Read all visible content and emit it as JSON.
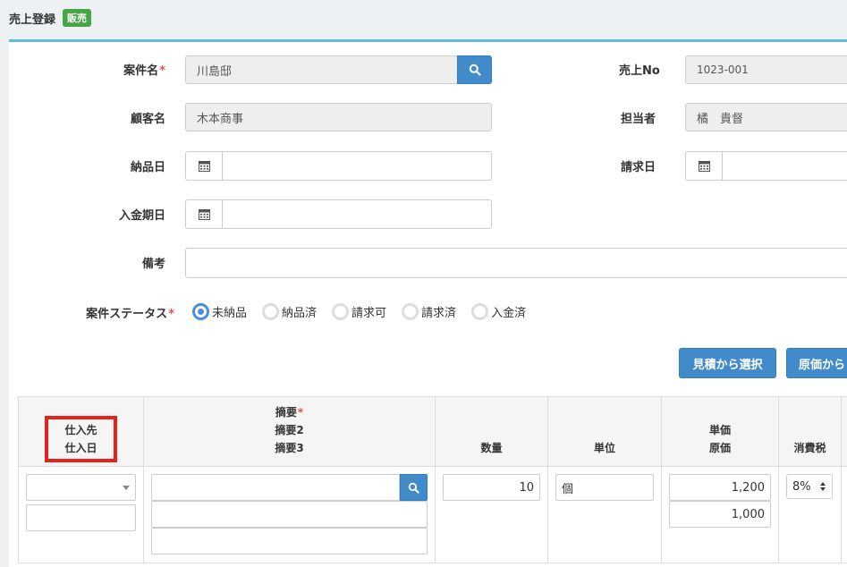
{
  "header": {
    "title": "売上登録",
    "badge": "販売"
  },
  "form": {
    "project_name": {
      "label": "案件名",
      "value": "川島邸"
    },
    "sales_no": {
      "label": "売上No",
      "value": "1023-001"
    },
    "customer": {
      "label": "顧客名",
      "value": "木本商事"
    },
    "staff": {
      "label": "担当者",
      "value": "橘　貴督"
    },
    "delivery_date": {
      "label": "納品日",
      "value": ""
    },
    "billing_date": {
      "label": "請求日",
      "value": ""
    },
    "payment_due": {
      "label": "入金期日",
      "value": ""
    },
    "memo": {
      "label": "備考",
      "value": ""
    },
    "status": {
      "label": "案件ステータス",
      "options": [
        "未納品",
        "納品済",
        "請求可",
        "請求済",
        "入金済"
      ],
      "selected": "未納品"
    },
    "required_mark": "*"
  },
  "buttons": {
    "from_estimate": "見積から選択",
    "from_cost": "原価から"
  },
  "table": {
    "headers": {
      "supplier": "仕入先",
      "purchase_date": "仕入日",
      "summary": "摘要",
      "summary2": "摘要2",
      "summary3": "摘要3",
      "quantity": "数量",
      "unit": "単位",
      "unit_price": "単価",
      "cost_price": "原価",
      "tax": "消費税"
    },
    "row": {
      "supplier": "",
      "purchase_date": "",
      "summary": "",
      "summary2": "",
      "summary3": "",
      "quantity": "10",
      "unit": "個",
      "unit_price": "1,200",
      "cost_price": "1,000",
      "tax": "8%"
    }
  },
  "colors": {
    "accent": "#428bca",
    "badge": "#47a447",
    "highlight": "#e4231c",
    "panel_top": "#5bc0de"
  }
}
